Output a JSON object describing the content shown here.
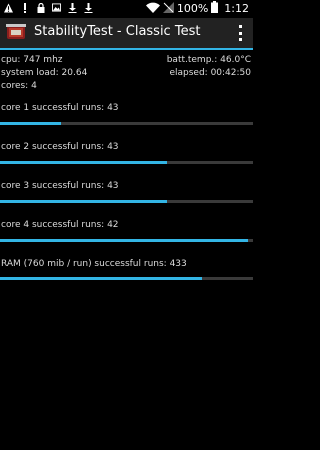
{
  "status_bar": {
    "battery": "100%",
    "time": "1:12",
    "left_icons": [
      "warning-icon",
      "alert-icon",
      "lock-icon",
      "image-icon",
      "download-icon",
      "download-icon"
    ],
    "right_icons": [
      "wifi-icon",
      "signal-off-icon",
      "battery-icon"
    ]
  },
  "action_bar": {
    "title": "StabilityTest - Classic Test",
    "accent_color": "#33b5e5",
    "background": "#222222",
    "menu_icon": "overflow-menu-icon"
  },
  "info": {
    "cpu": "cpu: 747 mhz",
    "batt_temp": "batt.temp.: 46.0°C",
    "system_load": "system load: 20.64",
    "elapsed": "elapsed: 00:42:50",
    "cores": "cores: 4"
  },
  "runs": [
    {
      "label": "core 1 successful runs: 43",
      "progress": 0.24
    },
    {
      "label": "core 2 successful runs: 43",
      "progress": 0.66
    },
    {
      "label": "core 3 successful runs: 43",
      "progress": 0.66
    },
    {
      "label": "core 4 successful runs: 42",
      "progress": 0.98
    },
    {
      "label": "RAM (760 mib / run) successful runs: 433",
      "progress": 0.8
    }
  ]
}
